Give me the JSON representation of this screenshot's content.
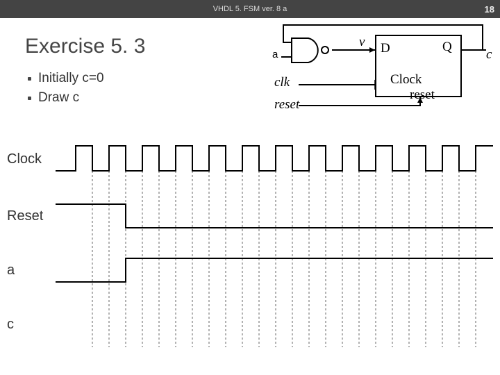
{
  "header": {
    "title": "VHDL 5. FSM ver. 8 a",
    "page": "18"
  },
  "exercise_title": "Exercise 5. 3",
  "bullets": {
    "b1": "Initially c=0",
    "b2": "Draw c"
  },
  "diagram": {
    "a": "a",
    "v": "v",
    "D": "D",
    "Q": "Q",
    "c": "c",
    "clk": "clk",
    "reset": "reset",
    "Clock": "Clock",
    "reset2": "reset"
  },
  "waves": {
    "clock": "Clock",
    "reset": "Reset",
    "a": "a",
    "c": "c"
  }
}
